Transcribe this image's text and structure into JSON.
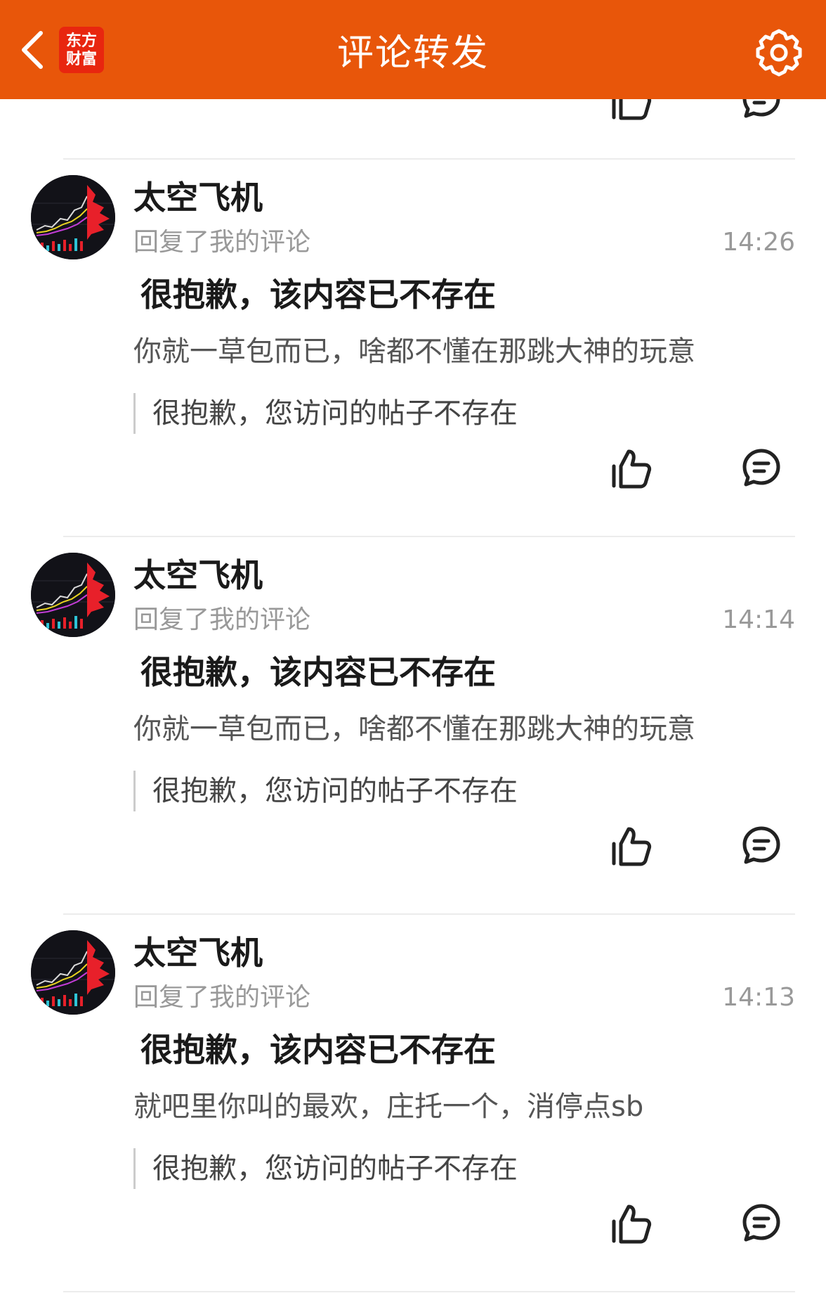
{
  "header": {
    "back_icon": "chevron-left-icon",
    "logo_line1": "东方",
    "logo_line2": "财富",
    "title": "评论转发",
    "settings_icon": "gear-icon"
  },
  "colors": {
    "header_bg": "#e8560a",
    "logo_bg": "#e8260f",
    "avatar_red": "#e8202a"
  },
  "comments": [
    {
      "username": "太空飞机",
      "subtitle": "回复了我的评论",
      "time": "14:26",
      "deleted_title": "很抱歉，该内容已不存在",
      "reply_text": "你就一草包而已，啥都不懂在那跳大神的玩意",
      "quote_text": "很抱歉，您访问的帖子不存在"
    },
    {
      "username": "太空飞机",
      "subtitle": "回复了我的评论",
      "time": "14:14",
      "deleted_title": "很抱歉，该内容已不存在",
      "reply_text": "你就一草包而已，啥都不懂在那跳大神的玩意",
      "quote_text": "很抱歉，您访问的帖子不存在"
    },
    {
      "username": "太空飞机",
      "subtitle": "回复了我的评论",
      "time": "14:13",
      "deleted_title": "很抱歉，该内容已不存在",
      "reply_text": "就吧里你叫的最欢，庄托一个，消停点sb",
      "quote_text": "很抱歉，您访问的帖子不存在"
    }
  ]
}
